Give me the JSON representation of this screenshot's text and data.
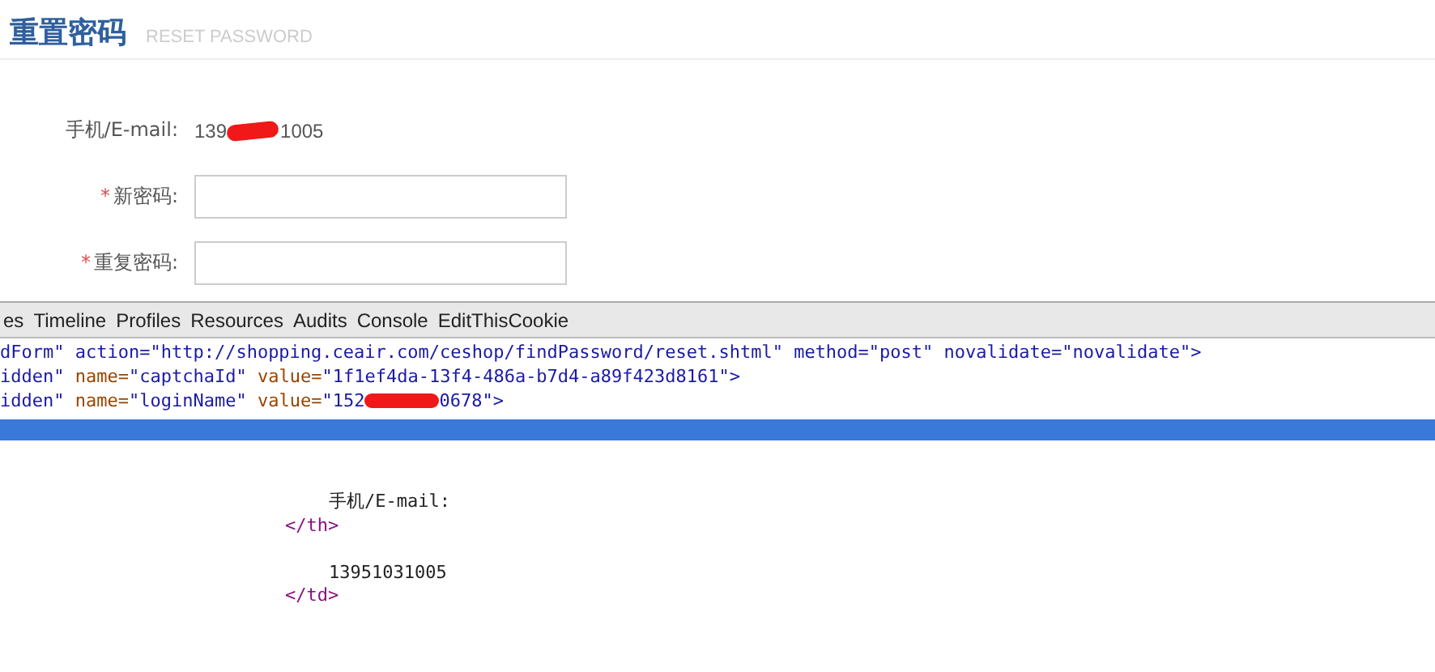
{
  "page_header": {
    "title": "重置密码",
    "subtitle": "RESET PASSWORD"
  },
  "form": {
    "account": {
      "label": "手机/E-mail:",
      "value_start": "139",
      "value_end": "1005"
    },
    "fields": [
      {
        "label": "新密码:",
        "required": true,
        "required_mark": "*"
      },
      {
        "label": "重复密码:",
        "required": true,
        "required_mark": "*"
      }
    ]
  },
  "devtools": {
    "tabs": [
      "es",
      "Timeline",
      "Profiles",
      "Resources",
      "Audits",
      "Console",
      "EditThisCookie"
    ],
    "code_lines": [
      {
        "kind": "plain",
        "text": "dForm\" action=\"http://shopping.ceair.com/ceshop/findPassword/reset.shtml\" method=\"post\" novalidate=\"novalidate\">"
      },
      {
        "kind": "attrs",
        "tag": "idden\"",
        "attrs": [
          {
            "name": "name=",
            "value": "\"captchaId\""
          },
          {
            "name": "value=",
            "value": "\"1f1ef4da-13f4-486a-b7d4-a89f423d8161\">"
          }
        ]
      },
      {
        "kind": "attrs",
        "tag": "idden\"",
        "attrs": [
          {
            "name": "name=",
            "value": "\"loginName\""
          },
          {
            "name": "value=",
            "value": "\"152",
            "value_end": "0678\">"
          }
        ]
      }
    ],
    "dom_lines": [
      {
        "kind": "text",
        "text": "手机/E-mail:"
      },
      {
        "kind": "tag",
        "text": "</th>"
      },
      {
        "kind": "blank"
      },
      {
        "kind": "text",
        "text": "13951031005"
      },
      {
        "kind": "tag",
        "text": "</td>"
      }
    ]
  }
}
